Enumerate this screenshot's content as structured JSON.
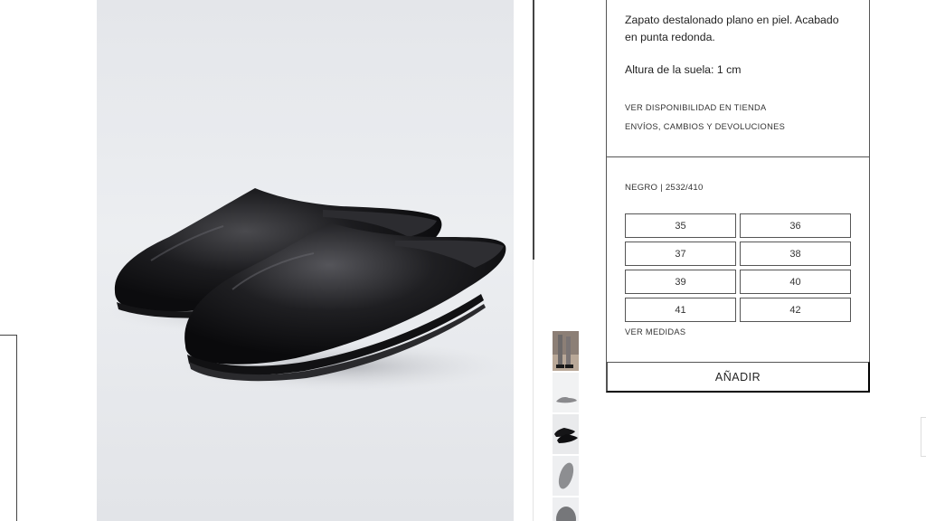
{
  "product": {
    "description": "Zapato destalonado plano en piel. Acabado en punta redonda.",
    "sole_height": "Altura de la suela: 1 cm",
    "links": {
      "store_availability": "VER DISPONIBILIDAD EN TIENDA",
      "shipping_returns": "ENVÍOS, CAMBIOS Y DEVOLUCIONES"
    }
  },
  "variant": {
    "color": "NEGRO",
    "reference": "2532/410"
  },
  "sizes": [
    "35",
    "36",
    "37",
    "38",
    "39",
    "40",
    "41",
    "42"
  ],
  "measures_link": "VER MEDIDAS",
  "add_button": "AÑADIR",
  "gallery": {
    "main_image": "black-leather-mule-shoes",
    "thumbnails": [
      "model-legs-thumbnail",
      "shoe-side-thumbnail",
      "shoe-pair-thumbnail",
      "sole-thumbnail",
      "sole-detail-thumbnail"
    ]
  }
}
